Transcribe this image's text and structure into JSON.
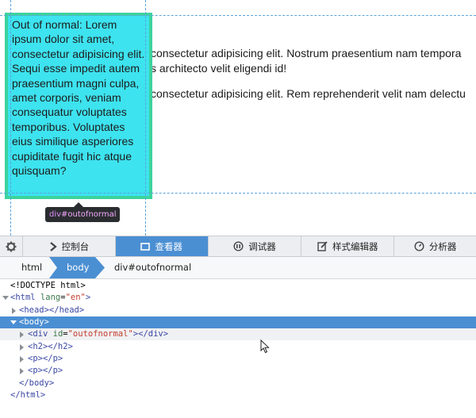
{
  "page": {
    "floating_box_text": "Out of normal: Lorem ipsum dolor sit amet, consectetur adipisicing elit. Sequi esse impedit autem praesentium magni culpa, amet corporis, veniam consequatur voluptates temporibus. Voluptates eius similique asperiores cupiditate fugit hic atque quisquam?",
    "paragraph_1_line_1": "consectetur adipisicing elit. Nostrum praesentium nam tempora",
    "paragraph_1_line_2": "s architecto velit eligendi id!",
    "paragraph_2_line_1": "consectetur adipisicing elit. Rem reprehenderit velit nam delectu",
    "infobar_tag": "div",
    "infobar_id": "#outofnormal",
    "highlight_fill_color": "#3de3ef",
    "highlight_border_color": "#3cd39f"
  },
  "toolbar": {
    "settings_icon": "gear-icon",
    "tabs": [
      {
        "label": "控制台",
        "icon": "console-icon"
      },
      {
        "label": "查看器",
        "icon": "inspector-icon",
        "active": true
      },
      {
        "label": "调试器",
        "icon": "debugger-icon"
      },
      {
        "label": "样式编辑器",
        "icon": "style-editor-icon"
      },
      {
        "label": "分析器",
        "icon": "profiler-icon"
      }
    ],
    "active_color": "#4b8fd3"
  },
  "breadcrumbs": [
    "html",
    "body",
    "div#outofnormal"
  ],
  "markup": {
    "doctype": "<!DOCTYPE html>",
    "html_open_tag": "<html",
    "html_lang_attr": "lang",
    "html_lang_value": "\"en\"",
    "html_close_bracket": ">",
    "head": "<head></head>",
    "body_open": "<body>",
    "div_open_tag": "<div",
    "div_id_attr": "id",
    "div_id_value": "\"outofnormal\"",
    "div_close": "></div>",
    "h2": "<h2></h2>",
    "p1": "<p></p>",
    "p2": "<p></p>",
    "body_close": "</body>",
    "html_close": "</html>"
  }
}
